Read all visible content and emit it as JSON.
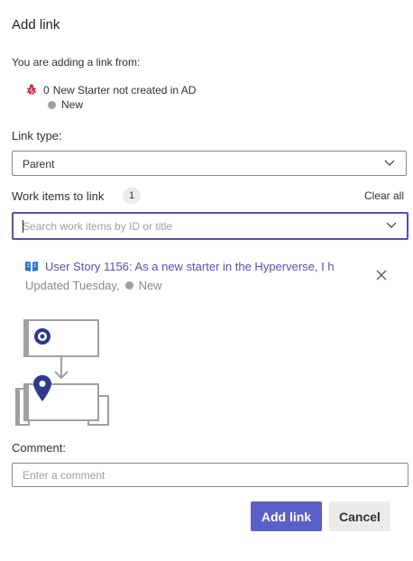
{
  "dialog": {
    "title": "Add link",
    "from_label": "You are adding a link from:"
  },
  "source_item": {
    "id": "0",
    "title": "New Starter not created in AD",
    "state": "New",
    "icon": "bug-icon"
  },
  "link_type": {
    "label": "Link type:",
    "value": "Parent"
  },
  "work_items": {
    "label": "Work items to link",
    "count": "1",
    "clear_all": "Clear all",
    "search_placeholder": "Search work items by ID or title"
  },
  "linked_item": {
    "title": "User Story 1156: As a new starter in the Hyperverse, I h",
    "updated": "Updated Tuesday,",
    "state": "New",
    "icon": "book-icon"
  },
  "comment": {
    "label": "Comment:",
    "placeholder": "Enter a comment"
  },
  "buttons": {
    "primary": "Add link",
    "secondary": "Cancel"
  },
  "colors": {
    "accent": "#5b5fc7",
    "link": "#4f52b2",
    "bug": "#cc293d",
    "illustration_dark": "#2e3a8c",
    "state_dot": "#a19f9d"
  }
}
